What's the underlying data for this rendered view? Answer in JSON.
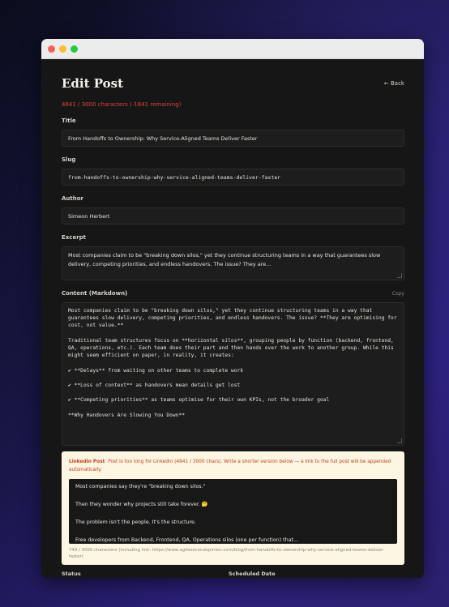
{
  "window": {
    "controls": [
      "close",
      "minimize",
      "zoom"
    ]
  },
  "header": {
    "title": "Edit Post",
    "back_label": "← Back"
  },
  "char_count": "4841 / 3000 characters (-1841 remaining)",
  "fields": {
    "title": {
      "label": "Title",
      "value": "From Handoffs to Ownership: Why Service-Aligned Teams Deliver Faster"
    },
    "slug": {
      "label": "Slug",
      "value": "from-handoffs-to-ownership-why-service-aligned-teams-deliver-faster"
    },
    "author": {
      "label": "Author",
      "value": "Simeon Herbert"
    },
    "excerpt": {
      "label": "Excerpt",
      "value": "Most companies claim to be \"breaking down silos,\" yet they continue structuring teams in a way that guarantees slow delivery, competing priorities, and endless handovers. The issue? They are..."
    },
    "content": {
      "label": "Content (Markdown)",
      "copy_label": "Copy",
      "paragraphs": [
        "Most companies claim to be \"breaking down silos,\" yet they continue structuring teams in a way that guarantees slow delivery, competing priorities, and endless handovers. The issue? **They are optimising for cost, not value.**",
        "Traditional team structures focus on **horizontal silos**, grouping people by function (backend, frontend, QA, operations, etc.). Each team does their part and then hands over the work to another group. While this might seem efficient on paper, in reality, it creates:",
        "✔ **Delays** from waiting on other teams to complete work",
        "✔ **Loss of context** as handovers mean details get lost",
        "✔ **Competing priorities** as teams optimise for their own KPIs, not the broader goal",
        "**Why Handovers Are Slowing You Down**"
      ]
    }
  },
  "linkedin": {
    "label": "LinkedIn Post",
    "notice": "Post is too long for LinkedIn (4841 / 3000 chars). Write a shorter version below — a link to the full post will be appended automatically.",
    "paragraphs": [
      "Most companies say they're \"breaking down silos.\"",
      "Then they wonder why projects still take forever. 🤔",
      "The problem isn't the people. It's the structure.",
      "Free developers from Backend, Frontend, QA, Operations silos (one per function) that..."
    ],
    "meta": "749 / 3000 characters (including link: https://www.agilesecondopinion.com/blog/from-handoffs-to-ownership-why-service-aligned-teams-deliver-faster)"
  },
  "bottom": {
    "status_label": "Status",
    "scheduled_label": "Scheduled Date"
  },
  "colors": {
    "window_bg": "#161616",
    "accent_red": "#e0433a",
    "linkedin_bg": "#fdf6e3",
    "linkedin_text": "#c4421d"
  }
}
